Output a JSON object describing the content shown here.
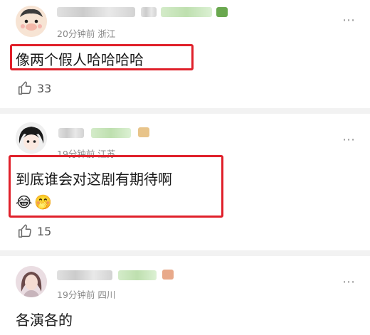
{
  "comments": [
    {
      "meta": "20分钟前 浙江",
      "text": "像两个假人哈哈哈哈",
      "likes": "33",
      "more_icon": "⋯"
    },
    {
      "meta": "19分钟前 江苏",
      "text": "到底谁会对这剧有期待啊",
      "emojis": [
        "😂",
        "🤭"
      ],
      "likes": "15",
      "more_icon": "⋯"
    },
    {
      "meta": "19分钟前 四川",
      "text": "各演各的",
      "more_icon": "⋯"
    }
  ],
  "colors": {
    "highlight": "#e0202a",
    "meta": "#888888",
    "divider": "#f2f2f2"
  }
}
